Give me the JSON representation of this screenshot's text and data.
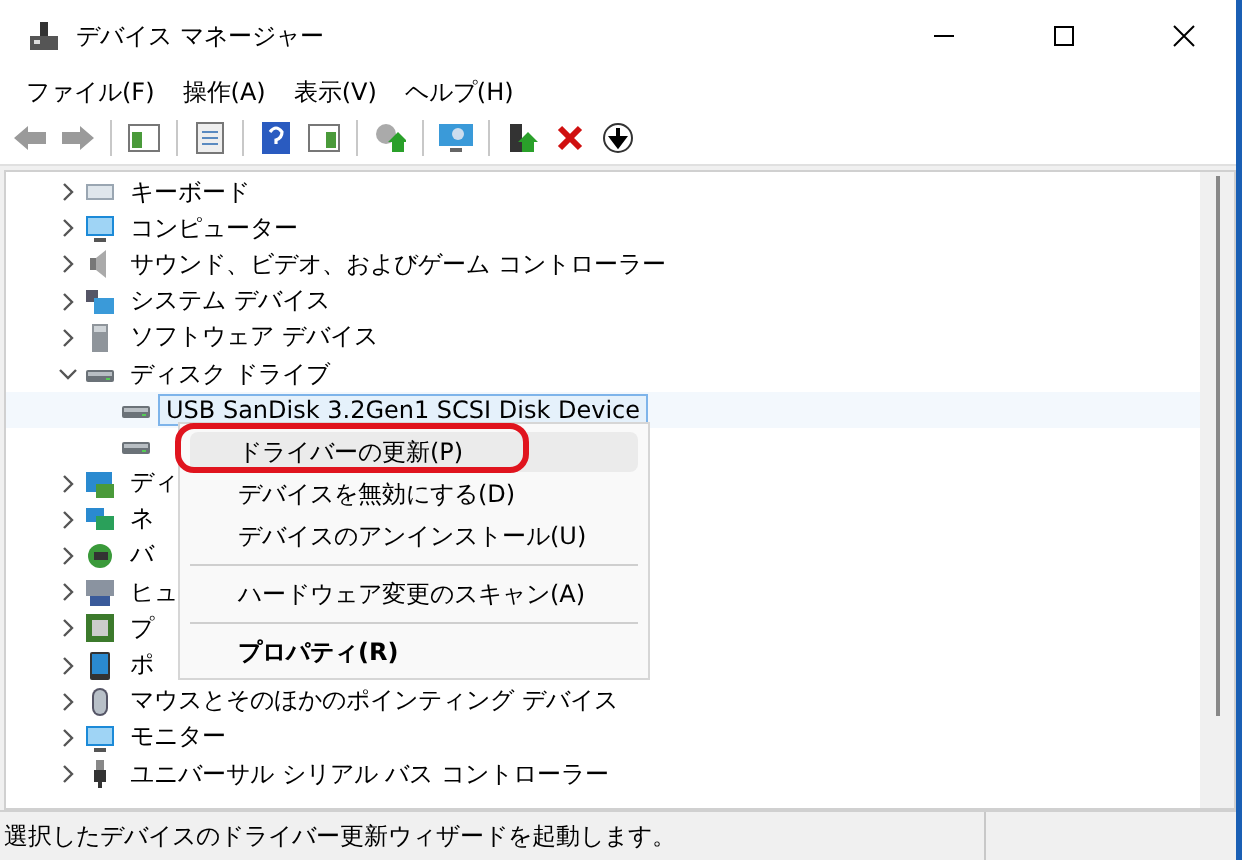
{
  "window": {
    "title": "デバイス マネージャー"
  },
  "menu_bar": [
    "ファイル(F)",
    "操作(A)",
    "表示(V)",
    "ヘルプ(H)"
  ],
  "tree": [
    {
      "label": "キーボード",
      "kind": "keyboard",
      "expanded": false,
      "selected": false
    },
    {
      "label": "コンピューター",
      "kind": "computer",
      "expanded": false,
      "selected": false
    },
    {
      "label": "サウンド、ビデオ、およびゲーム コントローラー",
      "kind": "speaker",
      "expanded": false,
      "selected": false
    },
    {
      "label": "システム デバイス",
      "kind": "system",
      "expanded": false,
      "selected": false
    },
    {
      "label": "ソフトウェア デバイス",
      "kind": "software",
      "expanded": false,
      "selected": false
    },
    {
      "label": "ディスク ドライブ",
      "kind": "disk",
      "expanded": true,
      "selected": false,
      "children": [
        {
          "label": "USB SanDisk 3.2Gen1 SCSI Disk Device",
          "kind": "disk",
          "selected": true
        },
        {
          "kind": "disk",
          "selected": false
        }
      ]
    },
    {
      "label": "ディ",
      "kind": "display",
      "expanded": false,
      "selected": false
    },
    {
      "label": "ネ",
      "kind": "network",
      "expanded": false,
      "selected": false
    },
    {
      "label": "バ",
      "kind": "battery",
      "expanded": false,
      "selected": false
    },
    {
      "label": "ヒュ",
      "kind": "hid",
      "expanded": false,
      "selected": false
    },
    {
      "label": "プ",
      "kind": "processor",
      "expanded": false,
      "selected": false
    },
    {
      "label": "ポ",
      "kind": "port",
      "expanded": false,
      "selected": false
    },
    {
      "label": "マウスとそのほかのポインティング デバイス",
      "kind": "mouse",
      "expanded": false,
      "selected": false
    },
    {
      "label": "モニター",
      "kind": "computer",
      "expanded": false,
      "selected": false
    },
    {
      "label": "ユニバーサル シリアル バス コントローラー",
      "kind": "usb",
      "expanded": false,
      "selected": false
    }
  ],
  "context_menu": {
    "items": [
      {
        "label": "ドライバーの更新(P)",
        "highlighted": true,
        "default": false,
        "separator_before": false
      },
      {
        "label": "デバイスを無効にする(D)",
        "highlighted": false,
        "default": false,
        "separator_before": false
      },
      {
        "label": "デバイスのアンインストール(U)",
        "highlighted": false,
        "default": false,
        "separator_before": false
      },
      {
        "label": "ハードウェア変更のスキャン(A)",
        "highlighted": false,
        "default": false,
        "separator_before": true
      },
      {
        "label": "プロパティ(R)",
        "highlighted": false,
        "default": true,
        "separator_before": true
      }
    ]
  },
  "status_bar": "選択したデバイスのドライバー更新ウィザードを起動します。"
}
